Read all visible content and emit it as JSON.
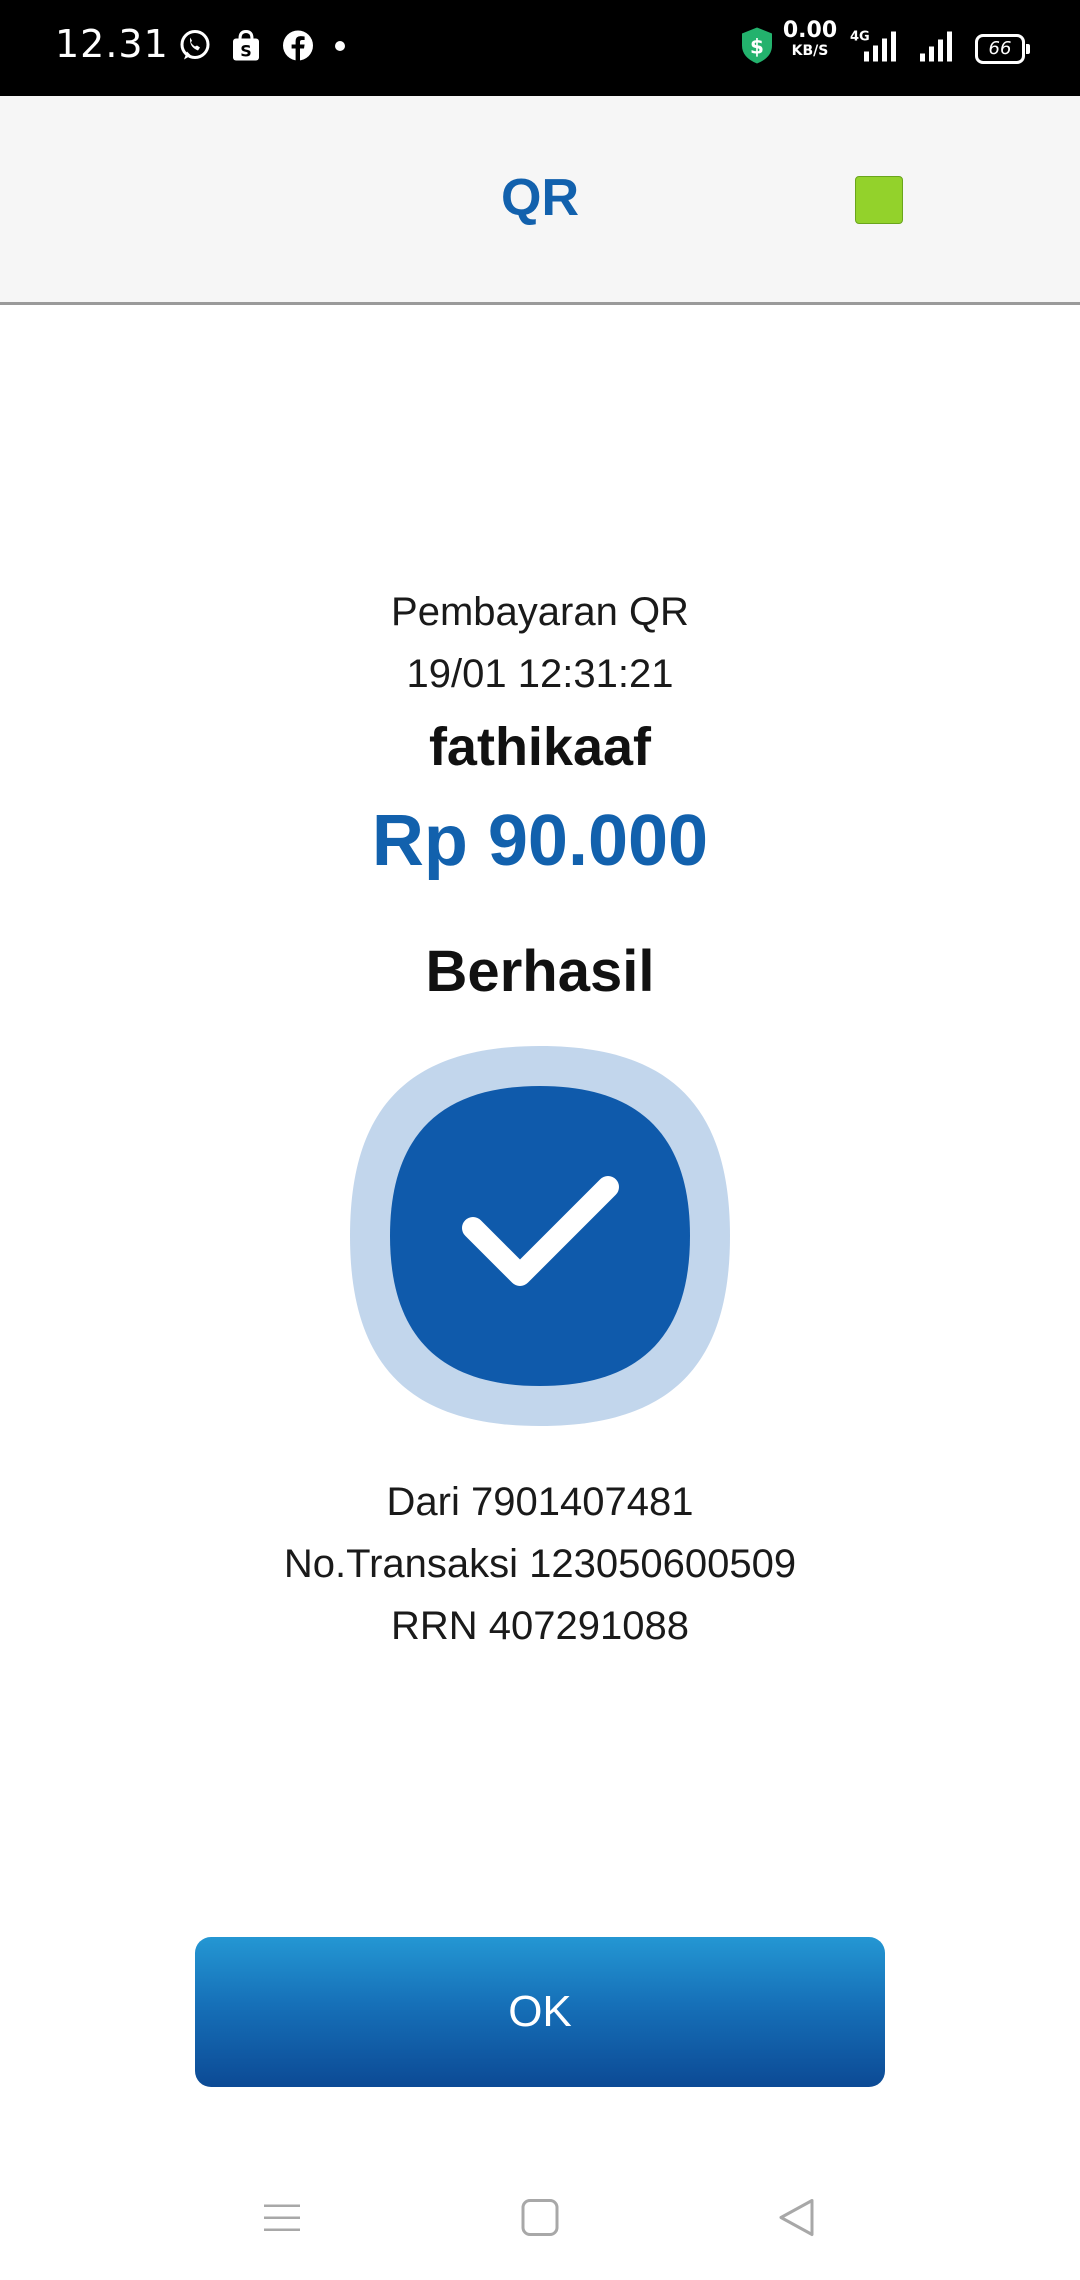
{
  "status_bar": {
    "time": "12.31",
    "net_speed_value": "0.00",
    "net_speed_unit": "KB/S",
    "network_type": "4G",
    "battery_level": "66",
    "notification_icons": [
      "whatsapp-icon",
      "shopping-bag-icon",
      "facebook-icon",
      "dot-icon"
    ]
  },
  "header": {
    "title": "QR",
    "accent_color": "#1261ad",
    "square_color": "#93d22b"
  },
  "receipt": {
    "transaction_type": "Pembayaran QR",
    "datetime": "19/01 12:31:21",
    "recipient": "fathikaaf",
    "amount": "Rp 90.000",
    "status": "Berhasil",
    "from": "Dari 7901407481",
    "transaction_no": "No.Transaksi 123050600509",
    "rrn": "RRN 407291088"
  },
  "actions": {
    "ok_label": "OK"
  },
  "navigation": {
    "buttons": [
      "menu-icon",
      "home-icon",
      "back-icon"
    ]
  }
}
